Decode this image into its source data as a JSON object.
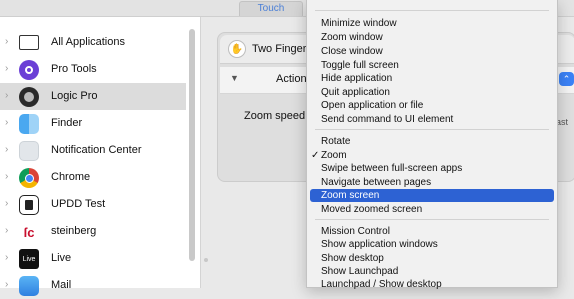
{
  "top_tab": "Touch",
  "apps": [
    {
      "label": "All Applications",
      "icon": "monitor-icon"
    },
    {
      "label": "Pro Tools",
      "icon": "pro-tools-icon"
    },
    {
      "label": "Logic Pro",
      "icon": "logic-pro-icon",
      "selected": true
    },
    {
      "label": "Finder",
      "icon": "finder-icon"
    },
    {
      "label": "Notification Center",
      "icon": "notification-center-icon"
    },
    {
      "label": "Chrome",
      "icon": "chrome-icon"
    },
    {
      "label": "UPDD Test",
      "icon": "upddtest-icon"
    },
    {
      "label": "steinberg",
      "icon": "steinberg-icon"
    },
    {
      "label": "Live",
      "icon": "live-icon",
      "badge": "Live"
    },
    {
      "label": "Mail",
      "icon": "mail-icon"
    }
  ],
  "panel": {
    "gesture_name": "Two Finger",
    "action_label": "Action:",
    "zoom_speed_label": "Zoom speed:",
    "fast_label": "ast"
  },
  "menu": {
    "items": [
      "Minimize window",
      "Zoom window",
      "Close window",
      "Toggle full screen",
      "Hide application",
      "Quit application",
      "Open application or file",
      "Send command to UI element",
      "Rotate",
      "Zoom",
      "Swipe between full-screen apps",
      "Navigate between pages",
      "Zoom screen",
      "Moved zoomed screen",
      "Mission Control",
      "Show application windows",
      "Show desktop",
      "Show Launchpad",
      "Launchpad / Show desktop"
    ],
    "checked_item": "Zoom",
    "highlighted_item": "Zoom screen"
  },
  "colors": {
    "highlight": "#2d62d3",
    "selection_row": "#dcdcdc",
    "accent_blue": "#3b82f6"
  }
}
